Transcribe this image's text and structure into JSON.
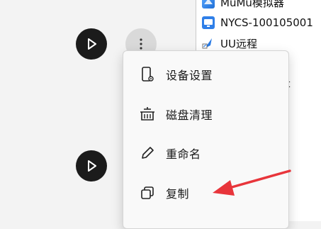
{
  "side_list": {
    "items": [
      {
        "label": "MuMu模拟器",
        "icon": "mumu-app-icon"
      },
      {
        "label": "NYCS-100105001",
        "icon": "api-app-icon"
      },
      {
        "label": "UU远程",
        "icon": "uu-remote-icon"
      }
    ],
    "peek_text": "t"
  },
  "context_menu": {
    "items": [
      {
        "label": "设备设置",
        "icon": "device-settings-icon"
      },
      {
        "label": "磁盘清理",
        "icon": "disk-cleanup-icon"
      },
      {
        "label": "重命名",
        "icon": "rename-pencil-icon"
      },
      {
        "label": "复制",
        "icon": "copy-icon"
      }
    ]
  },
  "annotation": {
    "arrow_color": "#e8353b"
  }
}
